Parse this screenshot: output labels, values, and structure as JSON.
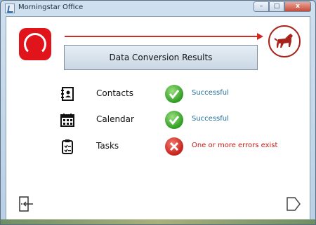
{
  "window": {
    "title": "Morningstar Office",
    "controls": {
      "minimize": "–",
      "maximize": "□",
      "close": "x"
    }
  },
  "header": {
    "heading": "Data Conversion Results"
  },
  "results": [
    {
      "label": "Contacts",
      "icon": "address-book-icon",
      "status": "Successful",
      "state": "success"
    },
    {
      "label": "Calendar",
      "icon": "calendar-icon",
      "status": "Successful",
      "state": "success"
    },
    {
      "label": "Tasks",
      "icon": "clipboard-checklist-icon",
      "status": "One or more errors exist",
      "state": "error"
    }
  ],
  "footer": {
    "exit_icon": "exit-door-icon",
    "next_icon": "next-arrow-icon"
  },
  "colors": {
    "accent_red": "#d12a22",
    "success_text": "#1e6b9a",
    "error_text": "#c11a14"
  }
}
